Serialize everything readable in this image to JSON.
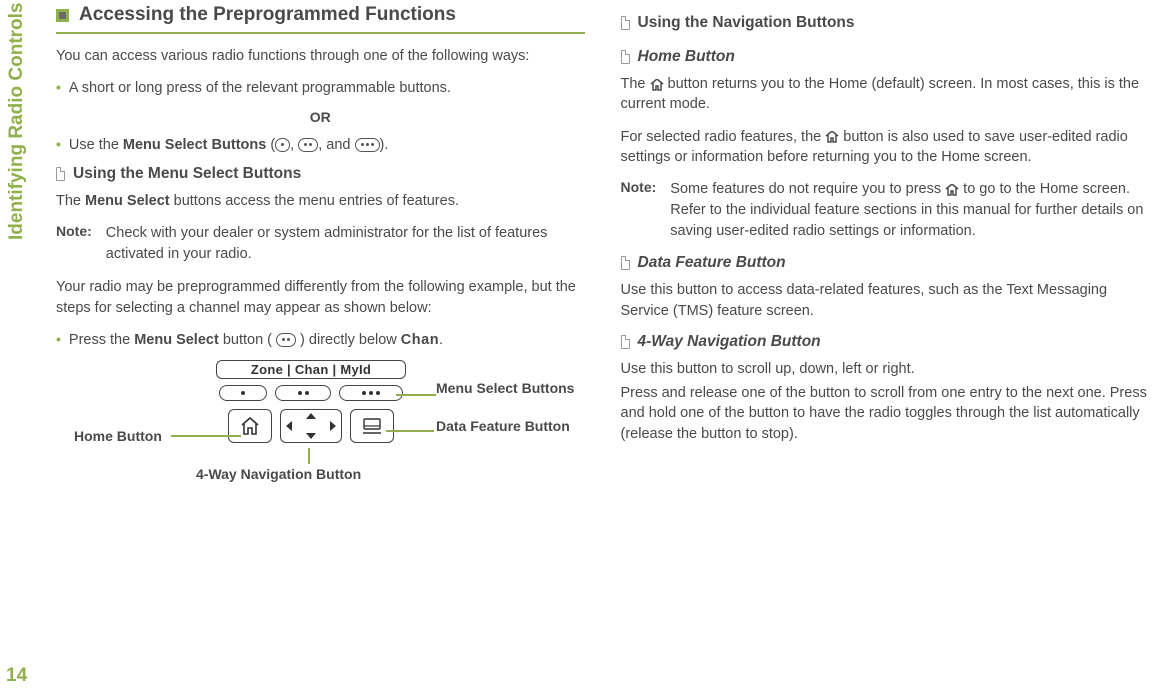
{
  "sidebar": {
    "section": "Identifying Radio Controls",
    "page": "14"
  },
  "left": {
    "h1": "Accessing the Preprogrammed Functions",
    "intro": "You can access various radio functions through one of the following ways:",
    "bullet1": "A short or long press of the relevant programmable buttons.",
    "or": "OR",
    "bullet2a": "Use the ",
    "bullet2b": "Menu Select Buttons",
    "bullet2c": " (",
    "bullet2d": ", ",
    "bullet2e": ", and ",
    "bullet2f": ").",
    "h2a": "Using the Menu Select Buttons",
    "p2a": "The ",
    "p2b": "Menu Select",
    "p2c": " buttons access the menu entries of features.",
    "noteLabel": "Note:",
    "note1": "Check with your dealer or system administrator for the list of features activated in your radio.",
    "p3": "Your radio may be preprogrammed differently from the following example, but the steps for selecting a channel may appear as shown below:",
    "bullet3a": "Press the ",
    "bullet3b": "Menu Select",
    "bullet3c": " button ( ",
    "bullet3d": " ) directly below ",
    "bullet3e": "Chan",
    "bullet3f": ".",
    "diagram": {
      "lcd": "Zone  |  Chan  |  MyId",
      "labelHome": "Home Button",
      "labelMenuSelect": "Menu Select Buttons",
      "labelData": "Data Feature Button",
      "label4way": "4-Way Navigation Button"
    }
  },
  "right": {
    "h2a": "Using the Navigation Buttons",
    "h2b": "Home Button",
    "p1a": "The ",
    "p1b": " button returns you to the Home (default) screen. In most cases, this is the current mode.",
    "p2a": "For selected radio features, the ",
    "p2b": " button is also used to save user-edited radio settings or information before returning you to the Home screen.",
    "noteLabel": "Note:",
    "note1a": "Some features do not require you to press ",
    "note1b": " to go to the Home screen. Refer to the individual feature sections in this manual for further details on saving user-edited radio settings or information.",
    "h2c": "Data Feature Button",
    "p3": "Use this button to access data-related features, such as the Text Messaging Service (TMS) feature screen.",
    "h2d": "4-Way Navigation Button",
    "p4": "Use this button to scroll up, down, left or right.",
    "p5": "Press and release one of the button to scroll from one entry to the next one. Press and hold one of the button to have the radio toggles through the list automatically (release the button to stop)."
  }
}
